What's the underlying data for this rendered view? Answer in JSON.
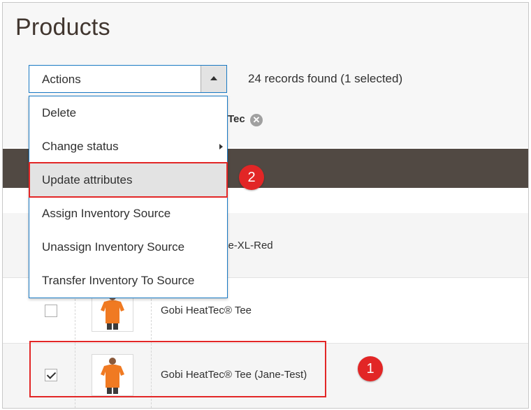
{
  "page": {
    "title": "Products"
  },
  "actions": {
    "label": "Actions",
    "items": [
      {
        "label": "Delete"
      },
      {
        "label": "Change status",
        "has_submenu": true
      },
      {
        "label": "Update attributes",
        "highlighted": true
      },
      {
        "label": "Assign Inventory Source"
      },
      {
        "label": "Unassign Inventory Source"
      },
      {
        "label": "Transfer Inventory To Source"
      }
    ]
  },
  "records_text": "24 records found (1 selected)",
  "active_filter": {
    "partial_text": "Tec",
    "remove_label": "✕"
  },
  "rows": [
    {
      "name": "c&amp;reg; Tee-XL-Red",
      "checked": false
    },
    {
      "name": "Gobi HeatTec® Tee",
      "checked": false
    },
    {
      "name": "Gobi HeatTec® Tee (Jane-Test)",
      "checked": true
    }
  ],
  "callouts": [
    {
      "number": "1"
    },
    {
      "number": "2"
    }
  ],
  "colors": {
    "accent_blue": "#1979c3",
    "header_dark": "#514943",
    "callout_red": "#e22626",
    "highlight": "#e3e3e3"
  }
}
